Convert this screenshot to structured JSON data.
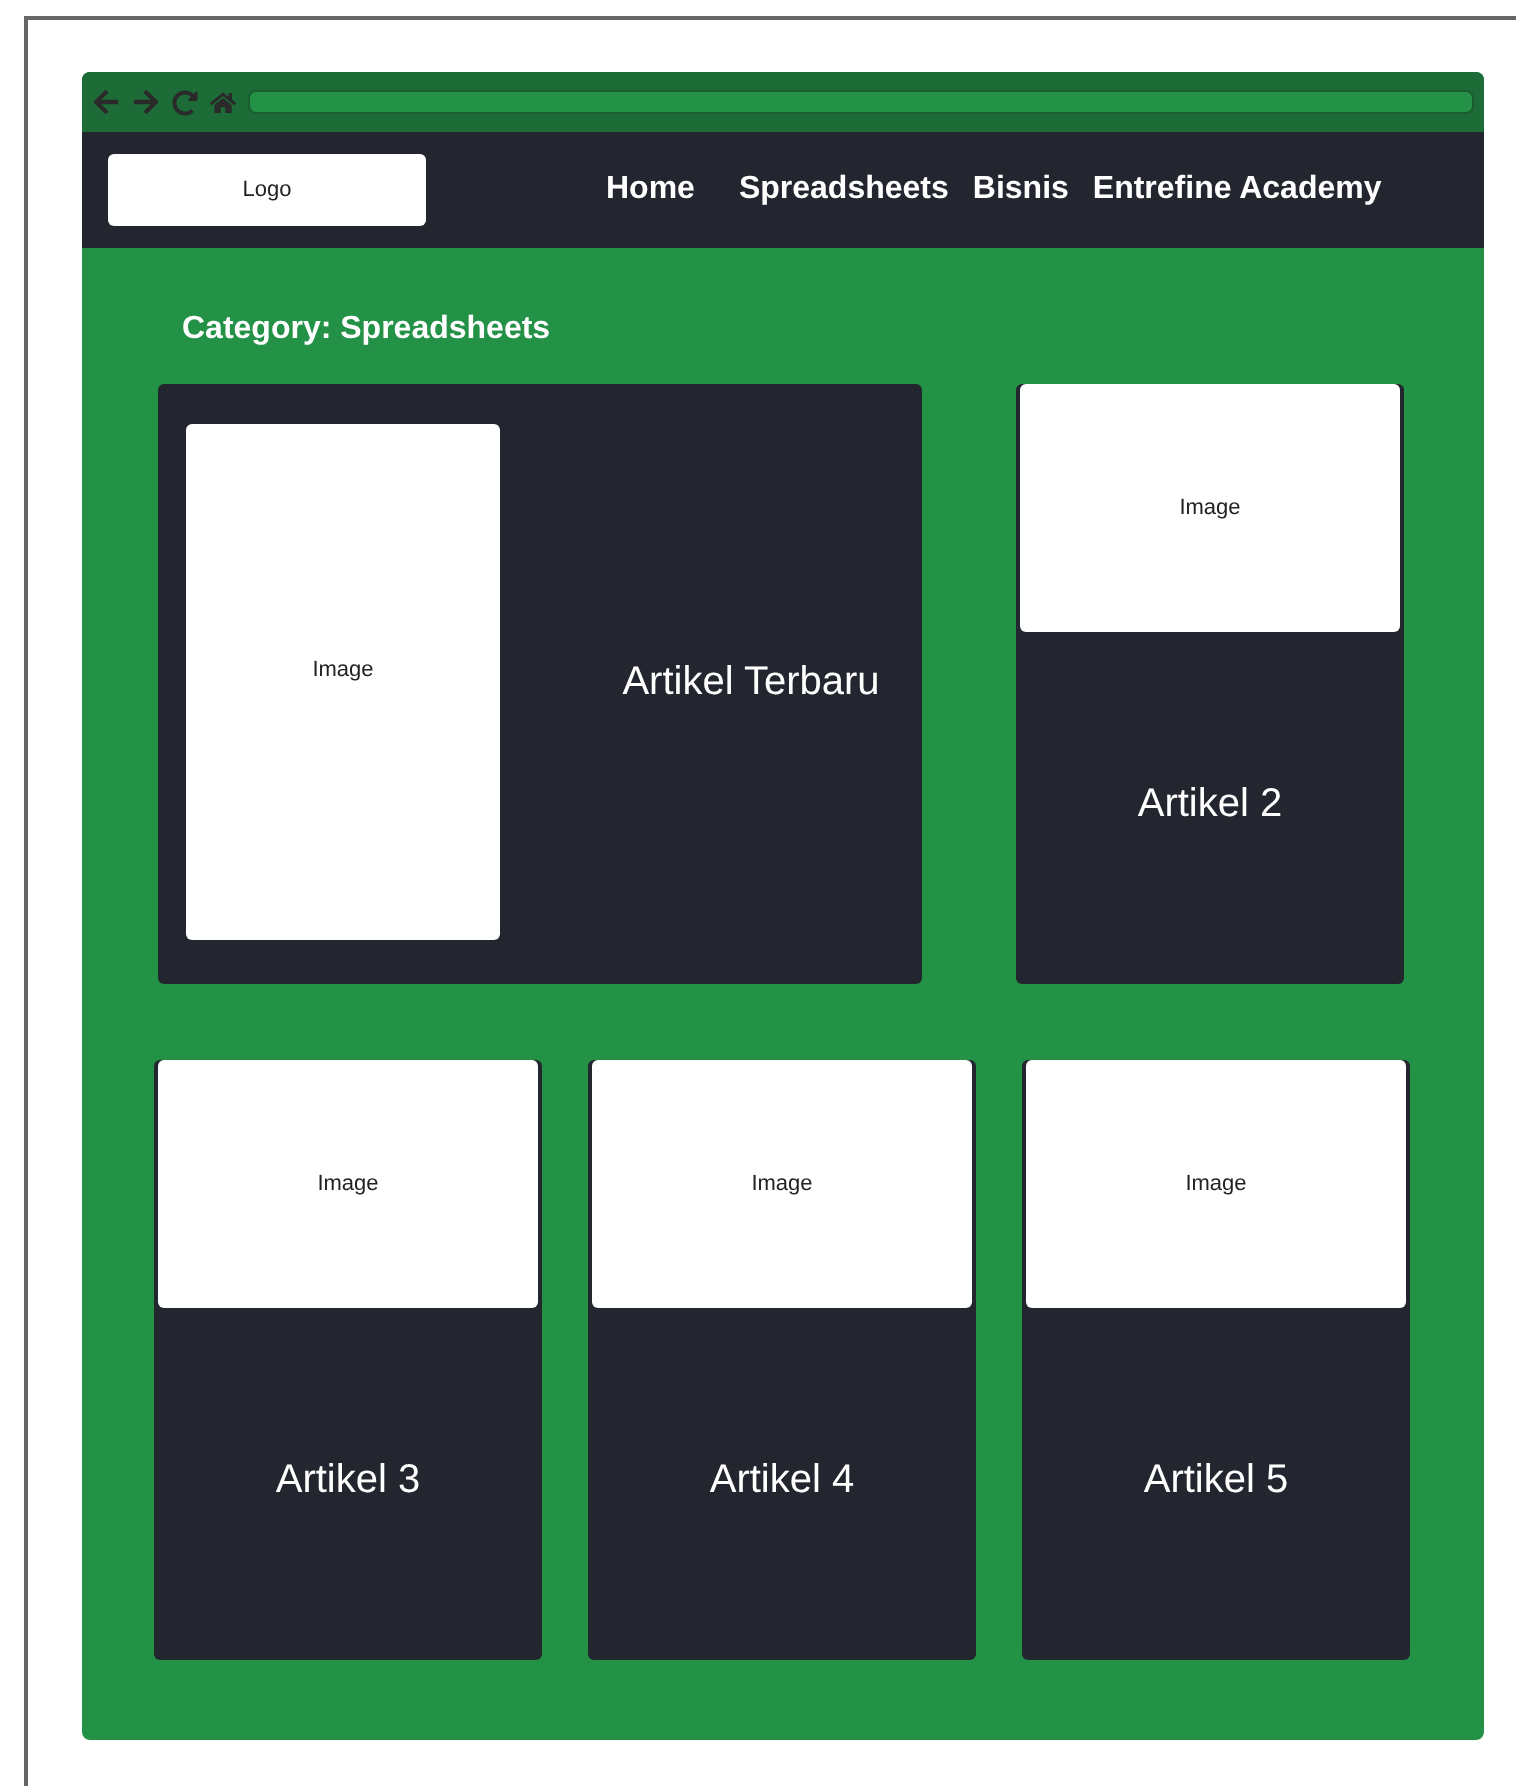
{
  "header": {
    "logo": "Logo",
    "nav": [
      "Home",
      "Spreadsheets",
      "Bisnis",
      "Entrefine Academy"
    ]
  },
  "category_title": "Category: Spreadsheets",
  "featured": {
    "image": "Image",
    "title": "Artikel Terbaru"
  },
  "articles": [
    {
      "image": "Image",
      "title": "Artikel 2"
    },
    {
      "image": "Image",
      "title": "Artikel 3"
    },
    {
      "image": "Image",
      "title": "Artikel 4"
    },
    {
      "image": "Image",
      "title": "Artikel 5"
    }
  ]
}
